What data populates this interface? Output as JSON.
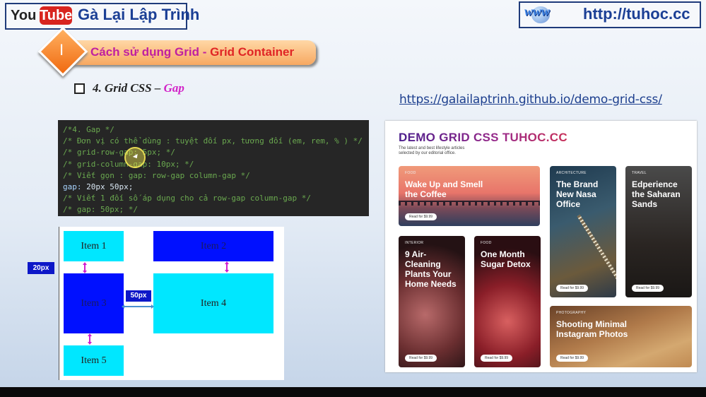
{
  "header": {
    "yt_you": "You",
    "yt_tube": "Tube",
    "channel": "Gà Lại Lập Trình",
    "www": "www",
    "site": "http://tuhoc.cc"
  },
  "banner": {
    "number": "I",
    "title_main": "Cách sử dụng Grid - ",
    "title_accent": "Grid Container"
  },
  "subtitle": {
    "prefix": "4. Grid CSS – ",
    "accent": "Gap"
  },
  "demo_link": "https://galailaptrinh.github.io/demo-grid-css/",
  "code": {
    "lines": [
      "/*4. Gap */",
      "/* Đơn vị có thể dùng : tuyệt đối px, tương đối (em, rem, % ) */",
      "/* grid-row-gap: 5px; */",
      "/* grid-column-gap: 10px; */",
      "/* Viết gọn : gap: row-gap column-gap */",
      "20px 50px;",
      "/* Viết 1 đối số áp dụng cho cả row-gap column-gap */",
      "/* gap: 50px; */"
    ],
    "keyword": "gap:"
  },
  "grid_demo": {
    "items": [
      "Item 1",
      "Item 2",
      "Item 3",
      "Item 4",
      "Item 5"
    ],
    "row_gap_label": "20px",
    "col_gap_label": "50px"
  },
  "demo_page": {
    "title": "DEMO GRID CSS TUHOC.CC",
    "tagline_1": "The latest and best lifestyle articles",
    "tagline_2": "selected by our editorial office.",
    "cards": [
      {
        "category": "FOOD",
        "headline": "Wake Up and Smell the Coffee",
        "button": "Read for $9.99"
      },
      {
        "category": "ARCHITECTURE",
        "headline": "The Brand New Nasa Office",
        "button": "Read for $9.99"
      },
      {
        "category": "TRAVEL",
        "headline": "Edperience the Saharan Sands",
        "button": "Read for $9.99"
      },
      {
        "category": "INTERIOR",
        "headline": "9 Air-Cleaning Plants Your Home Needs",
        "button": "Read for $9.99"
      },
      {
        "category": "FOOD",
        "headline": "One Month Sugar Detox",
        "button": "Read for $9.99"
      },
      {
        "category": "PHOTOGRAPHY",
        "headline": "Shooting Minimal Instagram Photos",
        "button": "Read for $9.99"
      }
    ]
  }
}
